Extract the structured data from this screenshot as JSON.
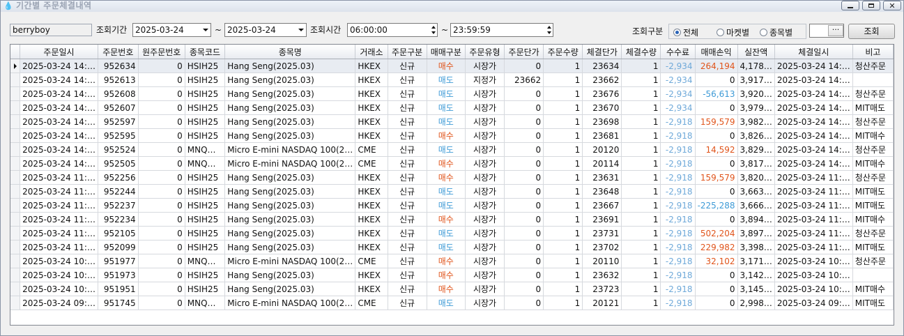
{
  "window": {
    "title": "기간별 주문체결내역",
    "buttons": {
      "minimize": "minimize",
      "maximize": "maximize",
      "close": "close"
    }
  },
  "filters": {
    "user_id": "berryboy",
    "date_label": "조회기간",
    "date_from": "2025-03-24",
    "date_tilde": "~",
    "date_to": "2025-03-24",
    "time_label": "조회시간",
    "time_from": "06:00:00",
    "time_tilde": "~",
    "time_to": "23:59:59",
    "type_label": "조회구분",
    "radio": [
      {
        "label": "전체",
        "checked": true
      },
      {
        "label": "마켓별",
        "checked": false
      },
      {
        "label": "종목별",
        "checked": false
      }
    ],
    "code_value": "",
    "ellipsis": "···",
    "search_button": "조회"
  },
  "table": {
    "columns": [
      "주문일시",
      "주문번호",
      "원주문번호",
      "종목코드",
      "종목명",
      "거래소",
      "주문구분",
      "매매구분",
      "주문유형",
      "주문단가",
      "주문수량",
      "체결단가",
      "체결수량",
      "수수료",
      "매매손익",
      "실잔액",
      "체결일시",
      "비고"
    ],
    "rows": [
      [
        "2025-03-24 14:…",
        "952634",
        "0",
        "HSIH25",
        "Hang Seng(2025.03)",
        "HKEX",
        "신규",
        "매수",
        "시장가",
        "0",
        "1",
        "23634",
        "1",
        "-2,934",
        "264,194",
        "4,178…",
        "2025-03-24 14:…",
        "청산주문"
      ],
      [
        "2025-03-24 14:…",
        "952613",
        "0",
        "HSIH25",
        "Hang Seng(2025.03)",
        "HKEX",
        "신규",
        "매도",
        "지정가",
        "23662",
        "1",
        "23662",
        "1",
        "-2,934",
        "0",
        "3,917…",
        "2025-03-24 14:…",
        ""
      ],
      [
        "2025-03-24 14:…",
        "952608",
        "0",
        "HSIH25",
        "Hang Seng(2025.03)",
        "HKEX",
        "신규",
        "매도",
        "시장가",
        "0",
        "1",
        "23676",
        "1",
        "-2,934",
        "-56,613",
        "3,920…",
        "2025-03-24 14:…",
        "청산주문"
      ],
      [
        "2025-03-24 14:…",
        "952607",
        "0",
        "HSIH25",
        "Hang Seng(2025.03)",
        "HKEX",
        "신규",
        "매도",
        "시장가",
        "0",
        "1",
        "23670",
        "1",
        "-2,934",
        "0",
        "3,979…",
        "2025-03-24 14:…",
        "MIT매도"
      ],
      [
        "2025-03-24 14:…",
        "952597",
        "0",
        "HSIH25",
        "Hang Seng(2025.03)",
        "HKEX",
        "신규",
        "매도",
        "시장가",
        "0",
        "1",
        "23698",
        "1",
        "-2,918",
        "159,579",
        "3,982…",
        "2025-03-24 14:…",
        "청산주문"
      ],
      [
        "2025-03-24 14:…",
        "952595",
        "0",
        "HSIH25",
        "Hang Seng(2025.03)",
        "HKEX",
        "신규",
        "매수",
        "시장가",
        "0",
        "1",
        "23681",
        "1",
        "-2,918",
        "0",
        "3,826…",
        "2025-03-24 14:…",
        "MIT매수"
      ],
      [
        "2025-03-24 14:…",
        "952524",
        "0",
        "MNQ…",
        "Micro E-mini NASDAQ 100(2…",
        "CME",
        "신규",
        "매도",
        "시장가",
        "0",
        "1",
        "20120",
        "1",
        "-2,918",
        "14,592",
        "3,829…",
        "2025-03-24 14:…",
        "청산주문"
      ],
      [
        "2025-03-24 14:…",
        "952505",
        "0",
        "MNQ…",
        "Micro E-mini NASDAQ 100(2…",
        "CME",
        "신규",
        "매수",
        "시장가",
        "0",
        "1",
        "20114",
        "1",
        "-2,918",
        "0",
        "3,817…",
        "2025-03-24 14:…",
        "MIT매수"
      ],
      [
        "2025-03-24 11:…",
        "952256",
        "0",
        "HSIH25",
        "Hang Seng(2025.03)",
        "HKEX",
        "신규",
        "매수",
        "시장가",
        "0",
        "1",
        "23631",
        "1",
        "-2,918",
        "159,579",
        "3,820…",
        "2025-03-24 11:…",
        "청산주문"
      ],
      [
        "2025-03-24 11:…",
        "952244",
        "0",
        "HSIH25",
        "Hang Seng(2025.03)",
        "HKEX",
        "신규",
        "매도",
        "시장가",
        "0",
        "1",
        "23648",
        "1",
        "-2,918",
        "0",
        "3,663…",
        "2025-03-24 11:…",
        "MIT매도"
      ],
      [
        "2025-03-24 11:…",
        "952237",
        "0",
        "HSIH25",
        "Hang Seng(2025.03)",
        "HKEX",
        "신규",
        "매도",
        "시장가",
        "0",
        "1",
        "23667",
        "1",
        "-2,918",
        "-225,288",
        "3,666…",
        "2025-03-24 11:…",
        "MIT매도"
      ],
      [
        "2025-03-24 11:…",
        "952234",
        "0",
        "HSIH25",
        "Hang Seng(2025.03)",
        "HKEX",
        "신규",
        "매수",
        "시장가",
        "0",
        "1",
        "23691",
        "1",
        "-2,918",
        "0",
        "3,894…",
        "2025-03-24 11:…",
        "MIT매수"
      ],
      [
        "2025-03-24 11:…",
        "952105",
        "0",
        "HSIH25",
        "Hang Seng(2025.03)",
        "HKEX",
        "신규",
        "매도",
        "시장가",
        "0",
        "1",
        "23731",
        "1",
        "-2,918",
        "502,204",
        "3,897…",
        "2025-03-24 11:…",
        "청산주문"
      ],
      [
        "2025-03-24 11:…",
        "952099",
        "0",
        "HSIH25",
        "Hang Seng(2025.03)",
        "HKEX",
        "신규",
        "매도",
        "시장가",
        "0",
        "1",
        "23702",
        "1",
        "-2,918",
        "229,982",
        "3,398…",
        "2025-03-24 11:…",
        "MIT매도"
      ],
      [
        "2025-03-24 10:…",
        "951977",
        "0",
        "MNQ…",
        "Micro E-mini NASDAQ 100(2…",
        "CME",
        "신규",
        "매수",
        "시장가",
        "0",
        "1",
        "20110",
        "1",
        "-2,918",
        "32,102",
        "3,171…",
        "2025-03-24 10:…",
        "청산주문"
      ],
      [
        "2025-03-24 10:…",
        "951973",
        "0",
        "HSIH25",
        "Hang Seng(2025.03)",
        "HKEX",
        "신규",
        "매수",
        "시장가",
        "0",
        "1",
        "23632",
        "1",
        "-2,918",
        "0",
        "3,142…",
        "2025-03-24 10:…",
        ""
      ],
      [
        "2025-03-24 10:…",
        "951951",
        "0",
        "HSIH25",
        "Hang Seng(2025.03)",
        "HKEX",
        "신규",
        "매수",
        "시장가",
        "0",
        "1",
        "23723",
        "1",
        "-2,918",
        "0",
        "3,145…",
        "2025-03-24 10:…",
        "MIT매수"
      ],
      [
        "2025-03-24 09:…",
        "951745",
        "0",
        "MNQ…",
        "Micro E-mini NASDAQ 100(2…",
        "CME",
        "신규",
        "매도",
        "시장가",
        "0",
        "1",
        "20121",
        "1",
        "-2,918",
        "0",
        "2,998…",
        "2025-03-24 09:…",
        "MIT매도"
      ]
    ]
  },
  "colors": {
    "buy": "#e0541b",
    "sell": "#3d9ad6",
    "fee": "#6fa9d9",
    "selected_row": "#e8ecf2"
  }
}
